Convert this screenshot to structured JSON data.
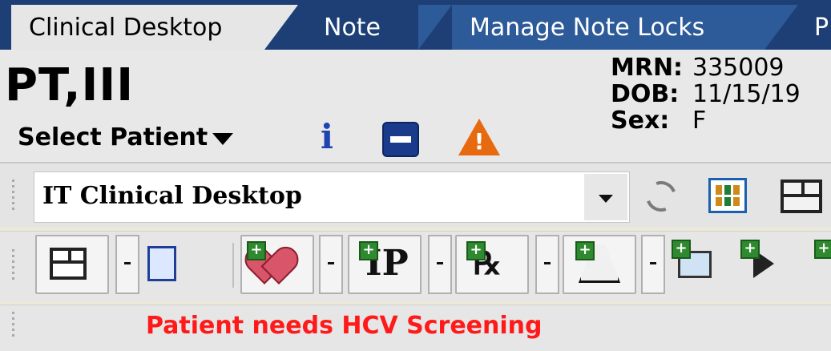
{
  "tabs": [
    {
      "label": "Clinical Desktop",
      "active": true
    },
    {
      "label": "Note",
      "active": false
    },
    {
      "label": "Manage Note Locks",
      "active": false
    },
    {
      "label": "P",
      "active": false
    }
  ],
  "patient": {
    "name": "PT,III",
    "select_label": "Select Patient",
    "mrn_label": "MRN:",
    "mrn": "335009",
    "dob_label": "DOB:",
    "dob": "11/15/19",
    "sex_label": "Sex:",
    "sex": "F"
  },
  "desktop_select": {
    "value": "IT Clinical Desktop"
  },
  "reminder": {
    "text": "Patient needs HCV Screening",
    "color": "#ff1a1a"
  },
  "colors": {
    "tab_bar": "#1d3f75",
    "accent_blue": "#1a3a8c",
    "warning": "#e86a10"
  },
  "icons": [
    "info-icon",
    "minus-icon",
    "warning-icon",
    "refresh-icon",
    "grid-icon",
    "layout-icon",
    "patient-card-icon",
    "heart-add-icon",
    "ip-add-icon",
    "rx-add-icon",
    "lab-add-icon",
    "book-add-icon",
    "forward-icon"
  ]
}
